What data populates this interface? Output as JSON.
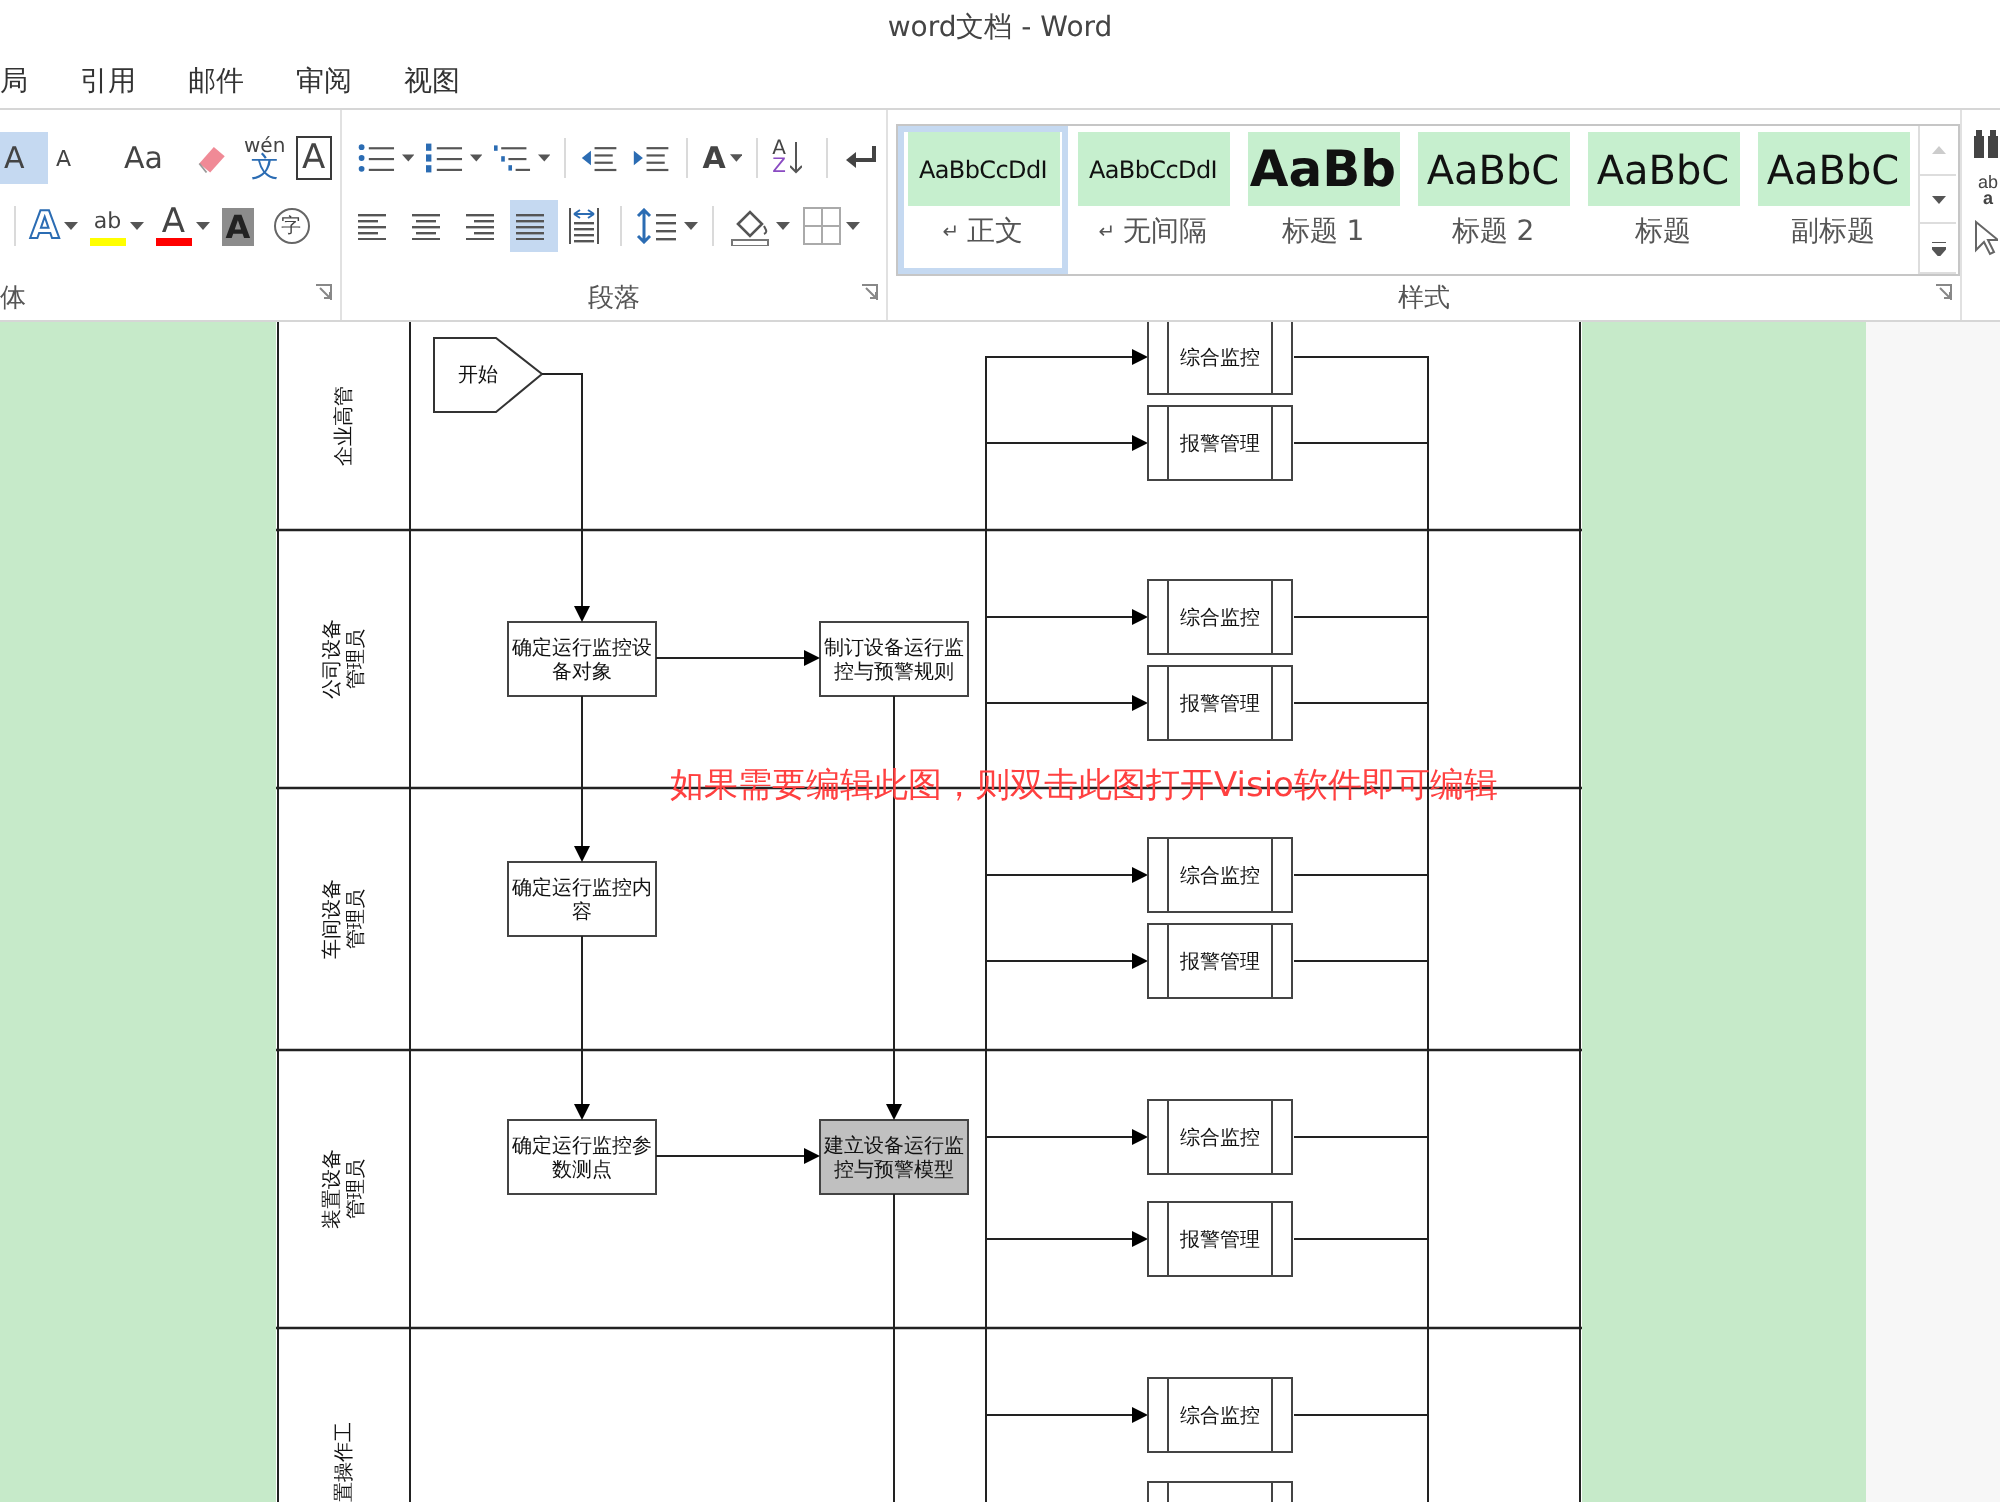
{
  "window": {
    "title": "word文档 - Word"
  },
  "menu_tabs": [
    {
      "label": "局",
      "selected": false
    },
    {
      "label": "引用",
      "selected": false
    },
    {
      "label": "邮件",
      "selected": false
    },
    {
      "label": "审阅",
      "selected": false
    },
    {
      "label": "视图",
      "selected": false
    }
  ],
  "ribbon": {
    "font_group": {
      "label": "体",
      "row1": [
        {
          "kind": "grow",
          "glyph": "A",
          "on": true
        },
        {
          "kind": "shrink",
          "glyph": "A",
          "on": false
        },
        {
          "kind": "case",
          "glyph": "Aa",
          "on": false
        },
        {
          "kind": "eraser",
          "on": false
        },
        {
          "kind": "phonetic",
          "glyph": "wén",
          "glyph2": "文",
          "on": false
        },
        {
          "kind": "border",
          "glyph": "A",
          "on": false
        }
      ],
      "row2": [
        {
          "kind": "effects",
          "glyph": "A",
          "on": false
        },
        {
          "kind": "highlight",
          "glyph": "ab",
          "color": "#ffff00",
          "on": false
        },
        {
          "kind": "fontcolor",
          "glyph": "A",
          "color": "#ff0000",
          "on": false
        },
        {
          "kind": "shading",
          "glyph": "A",
          "on": false
        },
        {
          "kind": "enclose",
          "glyph": "字",
          "on": false
        }
      ]
    },
    "paragraph_group": {
      "label": "段落",
      "row1": [
        {
          "kind": "bullets",
          "on": false
        },
        {
          "kind": "numbering",
          "on": false
        },
        {
          "kind": "multilevel",
          "on": false
        },
        {
          "kind": "outdent",
          "on": false
        },
        {
          "kind": "indent",
          "on": false
        },
        {
          "kind": "asian",
          "glyph": "A",
          "on": false
        },
        {
          "kind": "sort",
          "glyph": "A",
          "glyph2": "Z",
          "on": false
        },
        {
          "kind": "marks",
          "on": false
        }
      ],
      "row2": [
        {
          "kind": "left",
          "on": false
        },
        {
          "kind": "center",
          "on": false
        },
        {
          "kind": "right",
          "on": false
        },
        {
          "kind": "justify",
          "on": true
        },
        {
          "kind": "distribute",
          "on": false
        },
        {
          "kind": "spacing",
          "on": false
        },
        {
          "kind": "fill",
          "on": false
        },
        {
          "kind": "borders",
          "on": false
        }
      ]
    },
    "styles_group": {
      "label": "样式",
      "styles": [
        {
          "sample": "AaBbCcDdI",
          "name": "正文",
          "mark": "↵",
          "kind": "body",
          "selected": true
        },
        {
          "sample": "AaBbCcDdI",
          "name": "无间隔",
          "mark": "↵",
          "kind": "body",
          "selected": false
        },
        {
          "sample": "AaBb",
          "name": "标题 1",
          "kind": "heading1",
          "selected": false
        },
        {
          "sample": "AaBbC",
          "name": "标题 2",
          "kind": "heading2",
          "selected": false
        },
        {
          "sample": "AaBbC",
          "name": "标题",
          "kind": "heading",
          "selected": false
        },
        {
          "sample": "AaBbC",
          "name": "副标题",
          "kind": "heading",
          "selected": false
        }
      ]
    },
    "editing_group": {
      "replace_glyph": "ab",
      "replace_glyph2": "a"
    }
  },
  "diagram": {
    "lanes": [
      {
        "label": "企业高管",
        "nodes": [
          {
            "kind": "start",
            "text": "开始"
          }
        ],
        "outputs": [
          {
            "kind": "subprocess",
            "text": "综合监控"
          },
          {
            "kind": "subprocess",
            "text": "报警管理"
          }
        ]
      },
      {
        "label": "公司设备管理员",
        "nodes": [
          {
            "kind": "process",
            "text": "确定运行监控设备对象"
          },
          {
            "kind": "process",
            "text": "制订设备运行监控与预警规则"
          }
        ],
        "outputs": [
          {
            "kind": "subprocess",
            "text": "综合监控"
          },
          {
            "kind": "subprocess",
            "text": "报警管理"
          }
        ]
      },
      {
        "label": "车间设备管理员",
        "nodes": [
          {
            "kind": "process",
            "text": "确定运行监控内容"
          }
        ],
        "outputs": [
          {
            "kind": "subprocess",
            "text": "综合监控"
          },
          {
            "kind": "subprocess",
            "text": "报警管理"
          }
        ]
      },
      {
        "label": "装置设备管理员",
        "nodes": [
          {
            "kind": "process",
            "text": "确定运行监控参数测点"
          },
          {
            "kind": "shaded",
            "text": "建立设备运行监控与预警模型"
          }
        ],
        "outputs": [
          {
            "kind": "subprocess",
            "text": "综合监控"
          },
          {
            "kind": "subprocess",
            "text": "报警管理"
          }
        ]
      },
      {
        "label": "置操作工",
        "outputs": [
          {
            "kind": "subprocess",
            "text": "综合监控"
          },
          {
            "kind": "subprocess"
          }
        ]
      }
    ],
    "note": "如果需要编辑此图，则双击此图打开Visio软件即可编辑"
  }
}
